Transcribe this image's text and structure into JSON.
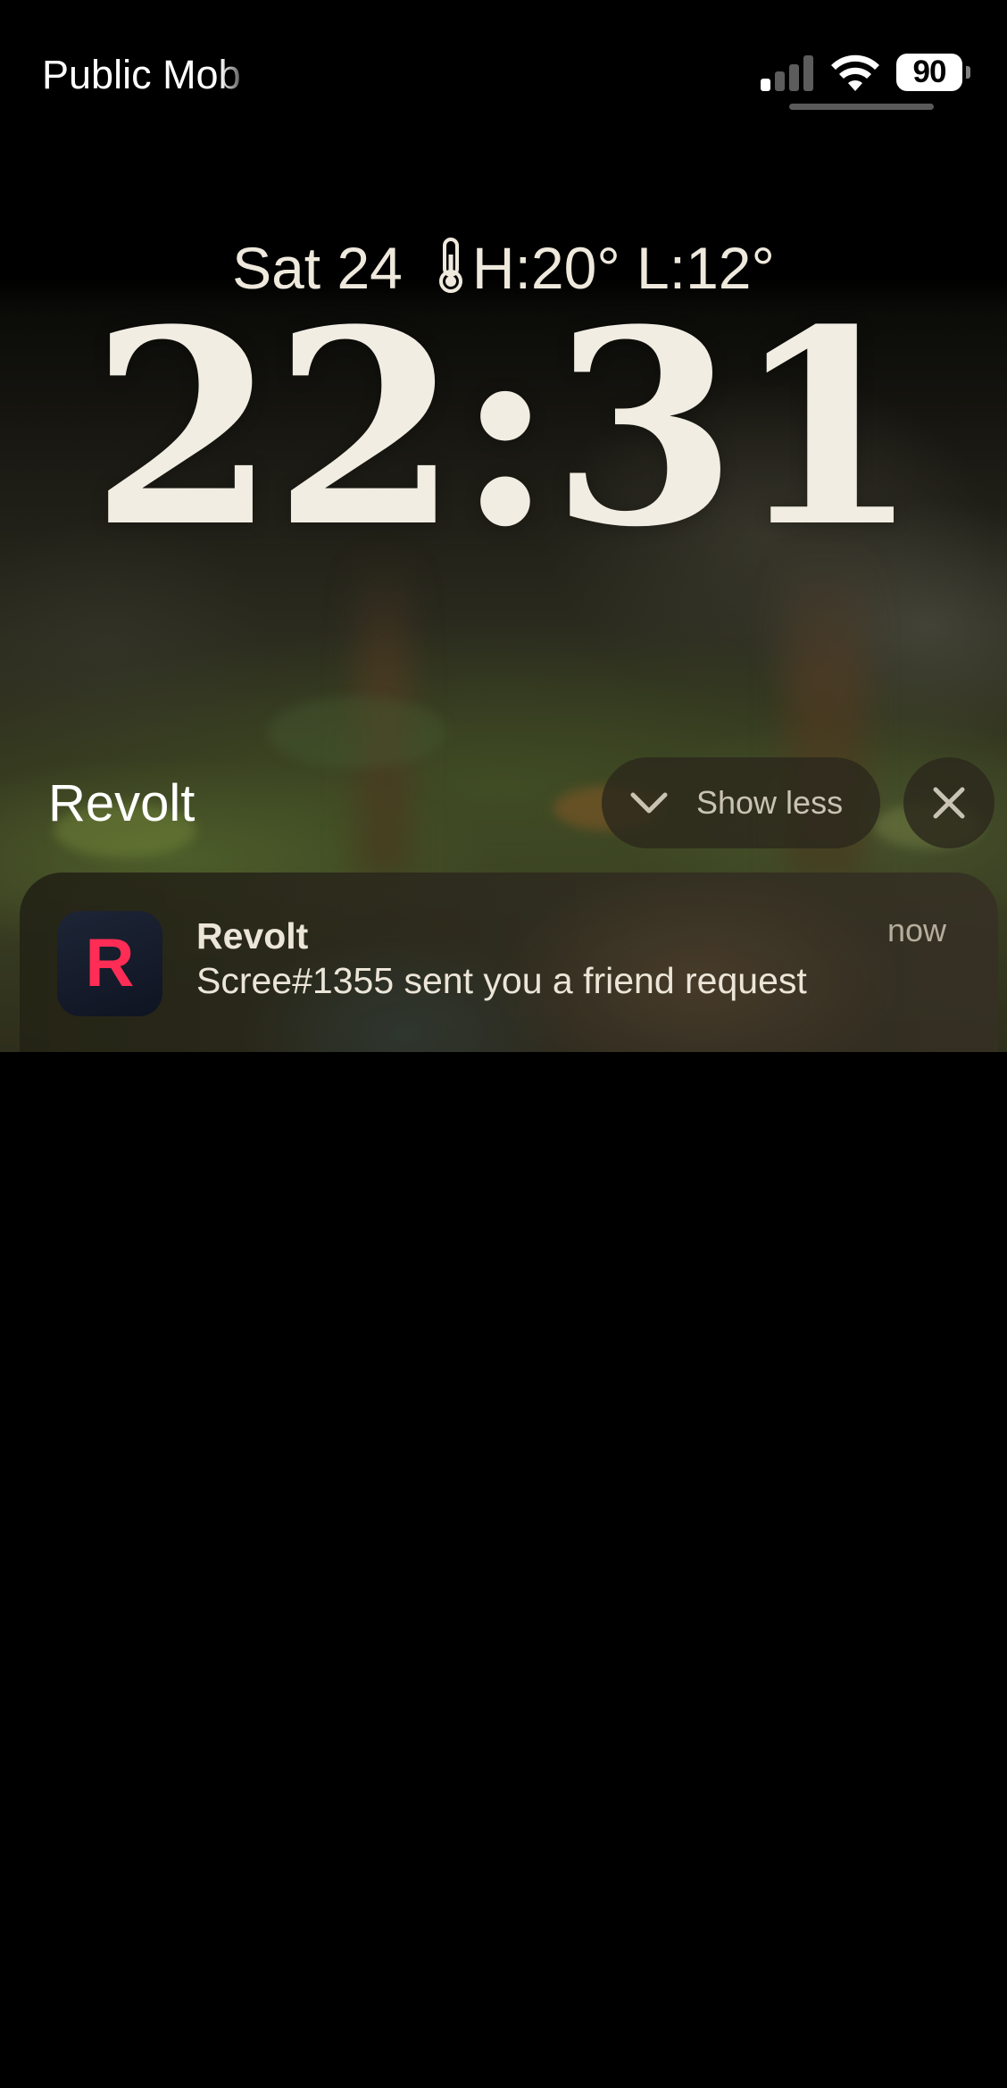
{
  "status_bar": {
    "carrier": "Public Mob",
    "battery_level": "90",
    "battery_fraction": 0.9,
    "signal_bars_active": 1,
    "signal_bars_total": 4,
    "icons": [
      "cellular-signal-icon",
      "wifi-icon",
      "battery-icon"
    ]
  },
  "lock_screen": {
    "date": "Sat 24",
    "weather": "H:20° L:12°",
    "weather_icon": "thermometer-icon",
    "time": "22:31"
  },
  "notification_group": {
    "title": "Revolt",
    "show_less_label": "Show less",
    "show_less_icon": "chevron-down-icon",
    "clear_icon": "close-icon"
  },
  "notification": {
    "app_icon_letter": "R",
    "app_icon_color": "#ff2d55",
    "app_name": "Revolt",
    "time": "now",
    "message": "Scree#1355 sent you a friend request"
  }
}
